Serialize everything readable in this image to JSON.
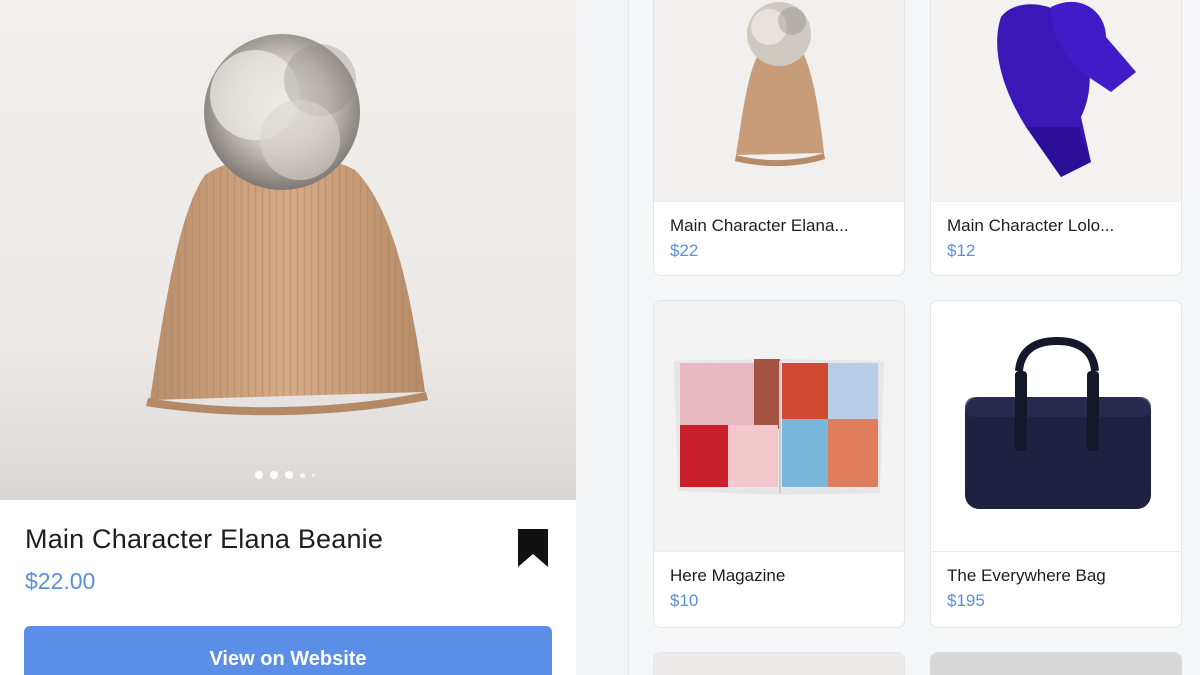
{
  "detail": {
    "title": "Main Character Elana Beanie",
    "price": "$22.00",
    "cta_label": "View on Website",
    "image_name": "beanie-photo",
    "carousel": {
      "count": 5,
      "active": 0
    }
  },
  "grid": {
    "items": [
      {
        "name": "Main Character Elana...",
        "price": "$22"
      },
      {
        "name": "Main Character Lolo...",
        "price": "$12"
      },
      {
        "name": "Here Magazine",
        "price": "$10"
      },
      {
        "name": "The Everywhere Bag",
        "price": "$195"
      }
    ]
  },
  "colors": {
    "accent_blue": "#5b8ee6",
    "price_blue": "#5b8fd6",
    "text": "#1c1e21"
  }
}
